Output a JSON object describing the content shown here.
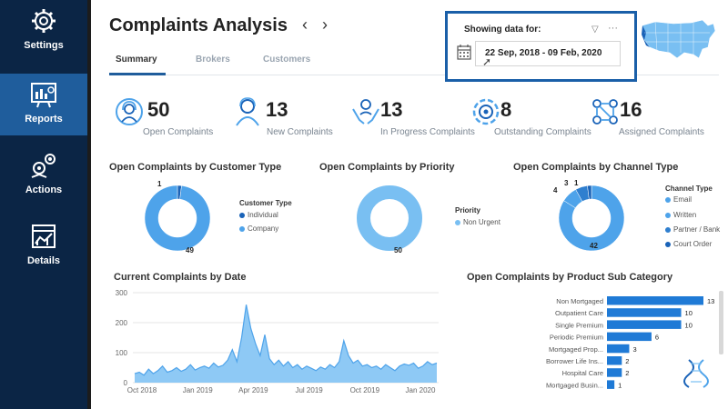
{
  "sidebar": {
    "items": [
      {
        "label": "Settings",
        "icon": "gear-icon"
      },
      {
        "label": "Reports",
        "icon": "report-icon"
      },
      {
        "label": "Actions",
        "icon": "actions-icon"
      },
      {
        "label": "Details",
        "icon": "details-icon"
      }
    ],
    "active": "Reports"
  },
  "header": {
    "title": "Complaints Analysis",
    "prev": "‹",
    "next": "›"
  },
  "tabs": [
    {
      "label": "Summary",
      "active": true
    },
    {
      "label": "Brokers",
      "active": false
    },
    {
      "label": "Customers",
      "active": false
    }
  ],
  "filter": {
    "title": "Showing data for:",
    "date_range": "22 Sep, 2018 - 09 Feb, 2020",
    "filter_icon": "▽",
    "more_icon": "···"
  },
  "kpis": [
    {
      "value": "50",
      "label": "Open Complaints",
      "icon": "headset-icon"
    },
    {
      "value": "13",
      "label": "New Complaints",
      "icon": "agent-icon"
    },
    {
      "value": "13",
      "label": "In Progress Complaints",
      "icon": "hands-icon"
    },
    {
      "value": "8",
      "label": "Outstanding Complaints",
      "icon": "cycle-icon"
    },
    {
      "value": "16",
      "label": "Assigned Complaints",
      "icon": "network-icon"
    }
  ],
  "colors": {
    "sidebar_bg": "#0b2545",
    "active_nav": "#1f5d9c",
    "accent": "#1a5fa8",
    "series_blue": "#4ea3ea",
    "light_blue": "#79bff2",
    "dark_blue": "#1a63b8"
  },
  "chart_data": [
    {
      "type": "pie",
      "title": "Open Complaints by Customer Type",
      "legend_title": "Customer Type",
      "categories": [
        "Individual",
        "Company"
      ],
      "values": [
        1,
        49
      ],
      "colors": [
        "#1a63b8",
        "#4ea3ea"
      ]
    },
    {
      "type": "pie",
      "title": "Open Complaints by Priority",
      "legend_title": "Priority",
      "categories": [
        "Non Urgent"
      ],
      "values": [
        50
      ],
      "colors": [
        "#79bff2"
      ]
    },
    {
      "type": "pie",
      "title": "Open Complaints by Channel Type",
      "legend_title": "Channel Type",
      "categories": [
        "Email",
        "Written",
        "Partner / Bank",
        "Court Order"
      ],
      "values": [
        42,
        4,
        3,
        1
      ],
      "colors": [
        "#4ea3ea",
        "#4ea3ea",
        "#2f7fcf",
        "#1a63b8"
      ]
    },
    {
      "type": "area",
      "title": "Current Complaints by Date",
      "x_ticks": [
        "Oct 2018",
        "Jan 2019",
        "Apr 2019",
        "Jul 2019",
        "Oct 2019",
        "Jan 2020"
      ],
      "y_ticks": [
        "0",
        "100",
        "200",
        "300"
      ],
      "ylim": [
        0,
        300
      ],
      "series": [
        {
          "values": [
            30,
            35,
            25,
            45,
            30,
            40,
            55,
            35,
            40,
            50,
            38,
            45,
            60,
            42,
            50,
            55,
            48,
            65,
            52,
            58,
            75,
            110,
            70,
            150,
            260,
            180,
            130,
            90,
            160,
            80,
            60,
            75,
            55,
            70,
            50,
            60,
            45,
            55,
            48,
            40,
            52,
            45,
            60,
            50,
            70,
            140,
            90,
            65,
            75,
            55,
            60,
            50,
            55,
            45,
            60,
            50,
            40,
            55,
            62,
            58,
            65,
            48,
            55,
            70,
            60,
            65
          ]
        }
      ]
    },
    {
      "type": "bar",
      "title": "Open Complaints by Product Sub Category",
      "categories": [
        "Non Mortgaged",
        "Outpatient Care",
        "Single Premium",
        "Periodic Premium",
        "Mortgaged Prop...",
        "Borrower Life Ins...",
        "Hospital Care",
        "Mortgaged Busin..."
      ],
      "values": [
        13,
        10,
        10,
        6,
        3,
        2,
        2,
        1
      ],
      "xlim": [
        0,
        13
      ]
    }
  ]
}
